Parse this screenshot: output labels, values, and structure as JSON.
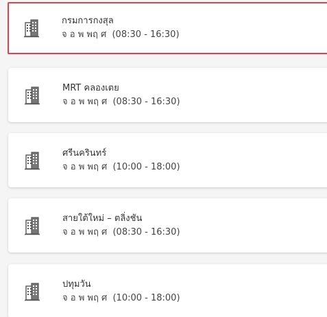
{
  "branches": [
    {
      "name": "กรมการกงสุล",
      "days": "จ อ พ พฤ ศ",
      "hours": "(08:30 - 16:30)",
      "selected": true,
      "icon": "office-building-icon"
    },
    {
      "name": "MRT คลองเตย",
      "days": "จ อ พ พฤ ศ",
      "hours": "(08:30 - 16:30)",
      "selected": false,
      "icon": "office-building-icon"
    },
    {
      "name": "ศรีนครินทร์",
      "days": "จ อ พ พฤ ศ",
      "hours": "(10:00 - 18:00)",
      "selected": false,
      "icon": "office-building-icon"
    },
    {
      "name": "สายใต้ใหม่ – ตลิ่งชัน",
      "days": "จ อ พ พฤ ศ",
      "hours": "(08:30 - 16:30)",
      "selected": false,
      "icon": "office-building-icon"
    },
    {
      "name": "ปทุมวัน",
      "days": "จ อ พ พฤ ศ",
      "hours": "(10:00 - 18:00)",
      "selected": false,
      "icon": "office-building-icon"
    }
  ],
  "colors": {
    "selected_border": "#e53e4d",
    "icon": "#555555"
  }
}
